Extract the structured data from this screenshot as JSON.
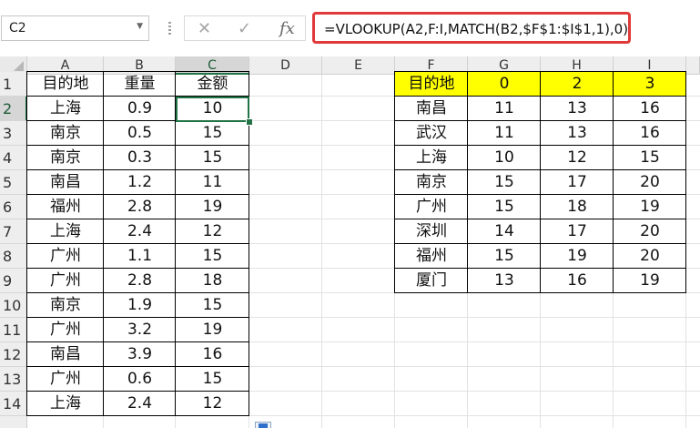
{
  "name_box": {
    "value": "C2"
  },
  "formula_bar": {
    "cancel_symbol": "✕",
    "enter_symbol": "✓",
    "fx_symbol": "fx",
    "formula": "=VLOOKUP(A2,F:I,MATCH(B2,$F$1:$I$1,1),0)"
  },
  "active_cell": "C2",
  "columns": [
    "A",
    "B",
    "C",
    "D",
    "E",
    "F",
    "G",
    "H",
    "I"
  ],
  "rows": [
    "1",
    "2",
    "3",
    "4",
    "5",
    "6",
    "7",
    "8",
    "9",
    "10",
    "11",
    "12",
    "13",
    "14"
  ],
  "table_left": {
    "headers": [
      "目的地",
      "重量",
      "金额"
    ],
    "rows": [
      [
        "上海",
        "0.9",
        "10"
      ],
      [
        "南京",
        "0.5",
        "15"
      ],
      [
        "南京",
        "0.3",
        "15"
      ],
      [
        "南昌",
        "1.2",
        "11"
      ],
      [
        "福州",
        "2.8",
        "19"
      ],
      [
        "上海",
        "2.4",
        "12"
      ],
      [
        "广州",
        "1.1",
        "15"
      ],
      [
        "广州",
        "2.8",
        "18"
      ],
      [
        "南京",
        "1.9",
        "15"
      ],
      [
        "广州",
        "3.2",
        "19"
      ],
      [
        "南昌",
        "3.9",
        "16"
      ],
      [
        "广州",
        "0.6",
        "15"
      ],
      [
        "上海",
        "2.4",
        "12"
      ]
    ]
  },
  "table_right": {
    "headers": [
      "目的地",
      "0",
      "2",
      "3"
    ],
    "header_fill": "#ffff00",
    "rows": [
      [
        "南昌",
        "11",
        "13",
        "16"
      ],
      [
        "武汉",
        "11",
        "13",
        "16"
      ],
      [
        "上海",
        "10",
        "12",
        "15"
      ],
      [
        "南京",
        "15",
        "17",
        "20"
      ],
      [
        "广州",
        "15",
        "18",
        "19"
      ],
      [
        "深圳",
        "14",
        "17",
        "20"
      ],
      [
        "福州",
        "15",
        "19",
        "20"
      ],
      [
        "厦门",
        "13",
        "16",
        "19"
      ]
    ]
  },
  "colors": {
    "selection_green": "#217346",
    "formula_highlight": "#e03a3a"
  }
}
